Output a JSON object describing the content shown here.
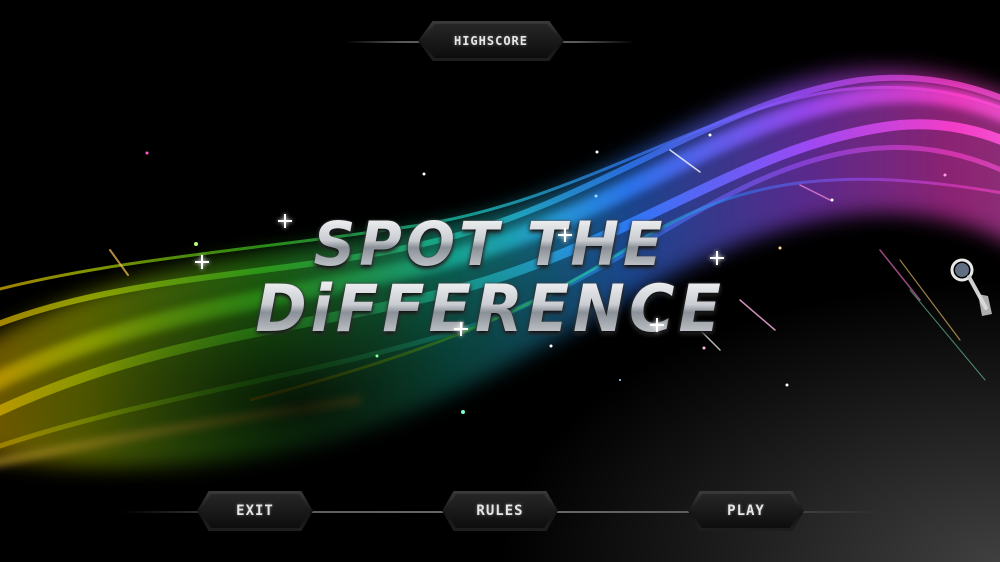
{
  "title": {
    "line1": "SPOT THE",
    "line2": "DiFFERENCE"
  },
  "menu": {
    "highscore_label": "HIGHSCORE",
    "exit_label": "EXIT",
    "rules_label": "RULES",
    "play_label": "PLAY"
  },
  "colors": {
    "background": "#000000",
    "button_text": "#e6e6e6",
    "title_silver": "#d9dde2"
  },
  "icons": {
    "magnifier": "magnifying-glass-icon"
  }
}
